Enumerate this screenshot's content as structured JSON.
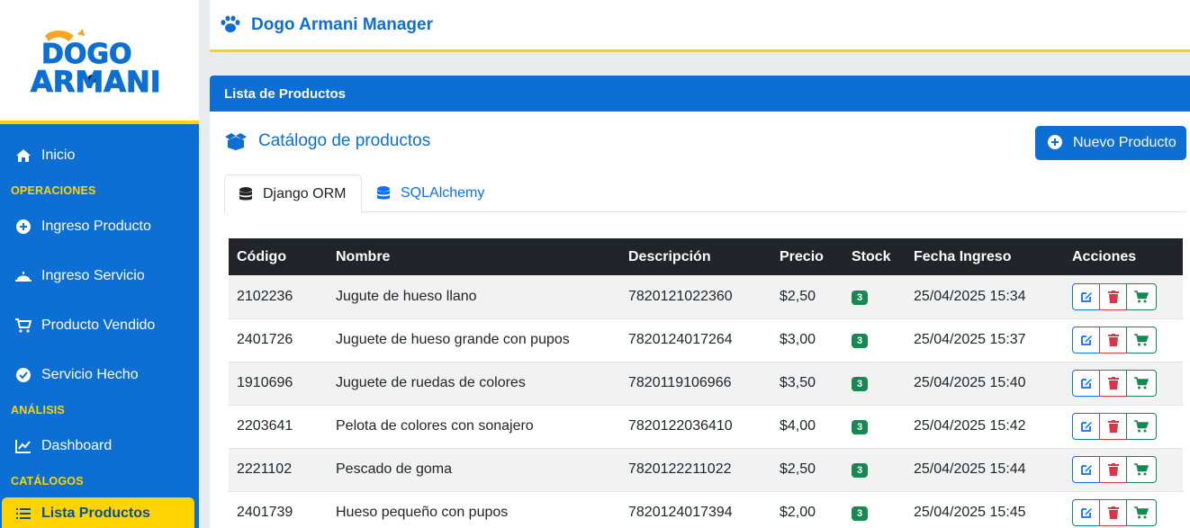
{
  "app": {
    "title": "Dogo Armani Manager",
    "logo_line1": "DOGO",
    "logo_line2": "ARMANI"
  },
  "sidebar": {
    "items": [
      {
        "label": "Inicio",
        "icon": "home-icon"
      },
      {
        "label": "Ingreso Producto",
        "icon": "plus-circle-icon"
      },
      {
        "label": "Ingreso Servicio",
        "icon": "bell-icon"
      },
      {
        "label": "Producto Vendido",
        "icon": "cart-icon"
      },
      {
        "label": "Servicio Hecho",
        "icon": "check-circle-icon"
      },
      {
        "label": "Dashboard",
        "icon": "line-chart-icon"
      },
      {
        "label": "Lista Productos",
        "icon": "list-icon",
        "active": true
      }
    ],
    "sections": [
      "OPERACIONES",
      "ANÁLISIS",
      "CATÁLOGOS"
    ]
  },
  "card": {
    "header": "Lista de Productos",
    "catalog_title": "Catálogo de productos",
    "new_button": "Nuevo Producto",
    "tabs": [
      {
        "label": "Django ORM",
        "active": true
      },
      {
        "label": "SQLAlchemy",
        "active": false
      }
    ]
  },
  "table": {
    "columns": [
      "Código",
      "Nombre",
      "Descripción",
      "Precio",
      "Stock",
      "Fecha Ingreso",
      "Acciones"
    ],
    "rows": [
      {
        "codigo": "2102236",
        "nombre": "Jugute de hueso llano",
        "descripcion": "7820121022360",
        "precio": "$2,50",
        "stock": "3",
        "fecha": "25/04/2025 15:34"
      },
      {
        "codigo": "2401726",
        "nombre": "Juguete de hueso grande con pupos",
        "descripcion": "7820124017264",
        "precio": "$3,00",
        "stock": "3",
        "fecha": "25/04/2025 15:37"
      },
      {
        "codigo": "1910696",
        "nombre": "Juguete de ruedas de colores",
        "descripcion": "7820119106966",
        "precio": "$3,50",
        "stock": "3",
        "fecha": "25/04/2025 15:40"
      },
      {
        "codigo": "2203641",
        "nombre": "Pelota de colores con sonajero",
        "descripcion": "7820122036410",
        "precio": "$4,00",
        "stock": "3",
        "fecha": "25/04/2025 15:42"
      },
      {
        "codigo": "2221102",
        "nombre": "Pescado de goma",
        "descripcion": "7820122211022",
        "precio": "$2,50",
        "stock": "3",
        "fecha": "25/04/2025 15:44"
      },
      {
        "codigo": "2401739",
        "nombre": "Hueso pequeño con pupos",
        "descripcion": "7820124017394",
        "precio": "$2,00",
        "stock": "3",
        "fecha": "25/04/2025 15:45"
      }
    ]
  },
  "colors": {
    "primary": "#0d6fd3",
    "accent": "#ffd400",
    "success": "#198754",
    "danger": "#dc3545"
  }
}
